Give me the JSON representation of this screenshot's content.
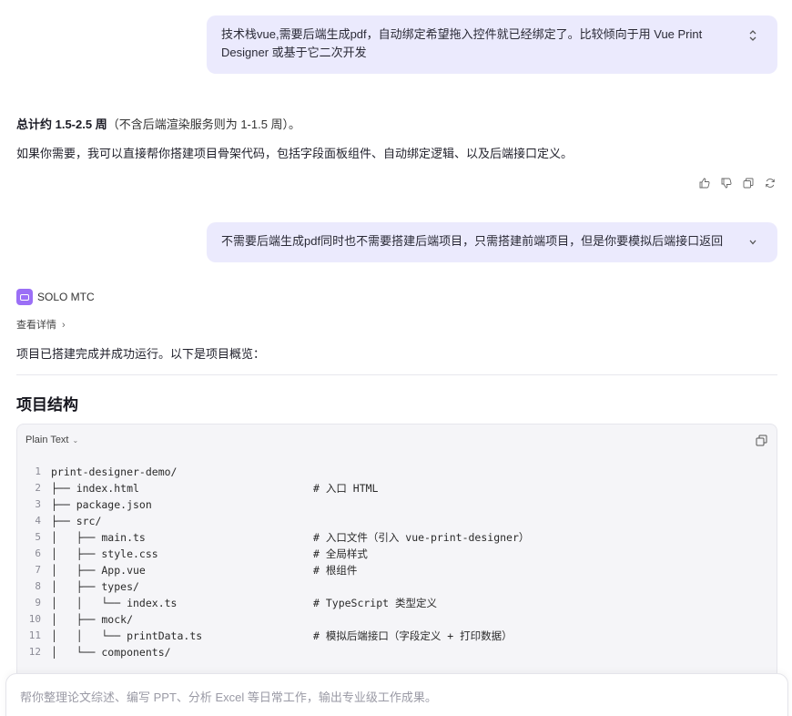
{
  "messages": {
    "user1": {
      "text": "技术栈vue,需要后端生成pdf，自动绑定希望拖入控件就已经绑定了。比较倾向于用 Vue Print Designer 或基于它二次开发",
      "toggle": "⌃⌄"
    },
    "assistant1": {
      "summary_bold": "总计约 1.5-2.5 周",
      "summary_rest": "（不含后端渲染服务则为 1-1.5 周）。",
      "offer": "如果你需要，我可以直接帮你搭建项目骨架代码，包括字段面板组件、自动绑定逻辑、以及后端接口定义。"
    },
    "user2": {
      "text": "不需要后端生成pdf同时也不需要搭建后端项目，只需搭建前端项目，但是你要模拟后端接口返回",
      "toggle": "⌄"
    }
  },
  "agent": {
    "name": "SOLO MTC",
    "details_label": "查看详情",
    "status": "项目已搭建完成并成功运行。以下是项目概览："
  },
  "section": {
    "title": "项目结构"
  },
  "code_block": {
    "language": "Plain Text",
    "lines": [
      {
        "n": "1",
        "code": "print-designer-demo/",
        "comment": ""
      },
      {
        "n": "2",
        "code": "├── index.html",
        "comment": "# 入口 HTML"
      },
      {
        "n": "3",
        "code": "├── package.json",
        "comment": ""
      },
      {
        "n": "4",
        "code": "├── src/",
        "comment": ""
      },
      {
        "n": "5",
        "code": "│   ├── main.ts",
        "comment": "# 入口文件（引入 vue-print-designer）"
      },
      {
        "n": "6",
        "code": "│   ├── style.css",
        "comment": "# 全局样式"
      },
      {
        "n": "7",
        "code": "│   ├── App.vue",
        "comment": "# 根组件"
      },
      {
        "n": "8",
        "code": "│   ├── types/",
        "comment": ""
      },
      {
        "n": "9",
        "code": "│   │   └── index.ts",
        "comment": "# TypeScript 类型定义"
      },
      {
        "n": "10",
        "code": "│   ├── mock/",
        "comment": ""
      },
      {
        "n": "11",
        "code": "│   │   └── printData.ts",
        "comment": "# 模拟后端接口（字段定义 + 打印数据）"
      },
      {
        "n": "12",
        "code": "│   └── components/",
        "comment": ""
      }
    ]
  },
  "composer": {
    "placeholder": "帮你整理论文综述、编写 PPT、分析 Excel 等日常工作，输出专业级工作成果。"
  },
  "icons": [
    "thumbs-up-icon",
    "thumbs-down-icon",
    "copy-icon",
    "regenerate-icon",
    "chevron-right-icon",
    "chevron-down-icon",
    "agent-logo-icon"
  ],
  "colors": {
    "user_bubble": "#ebeafd",
    "agent_logo": "#9b6ff6",
    "code_bg": "#f5f5f8"
  }
}
